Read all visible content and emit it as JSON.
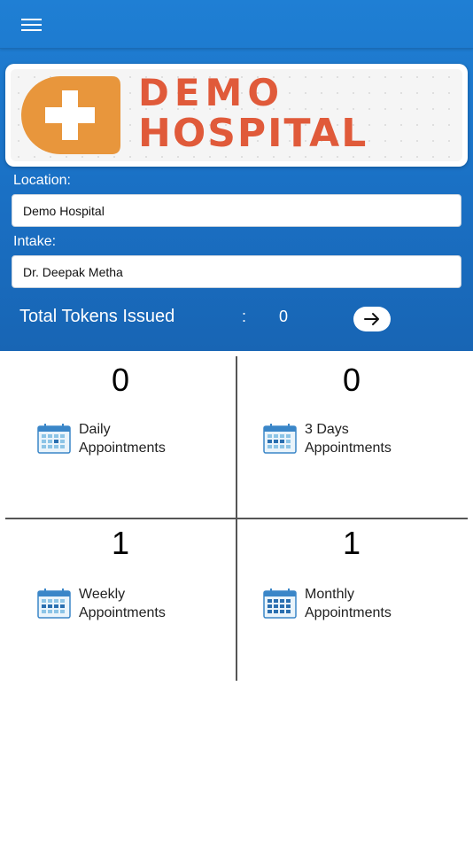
{
  "hospital": {
    "logo_line1": "DEMO",
    "logo_line2": "HOSPITAL"
  },
  "location": {
    "label": "Location:",
    "value": "Demo Hospital"
  },
  "intake": {
    "label": "Intake:",
    "value": "Dr. Deepak Metha"
  },
  "tokens": {
    "label": "Total Tokens Issued",
    "separator": ":",
    "value": "0"
  },
  "stats": [
    {
      "count": "0",
      "line1": "Daily",
      "line2": "Appointments"
    },
    {
      "count": "0",
      "line1": "3 Days",
      "line2": "Appointments"
    },
    {
      "count": "1",
      "line1": "Weekly",
      "line2": "Appointments"
    },
    {
      "count": "1",
      "line1": "Monthly",
      "line2": "Appointments"
    }
  ],
  "colors": {
    "header_blue": "#1a70c4",
    "logo_orange": "#e8963c",
    "logo_red": "#e05a3a",
    "calendar_blue": "#3a86c8"
  }
}
